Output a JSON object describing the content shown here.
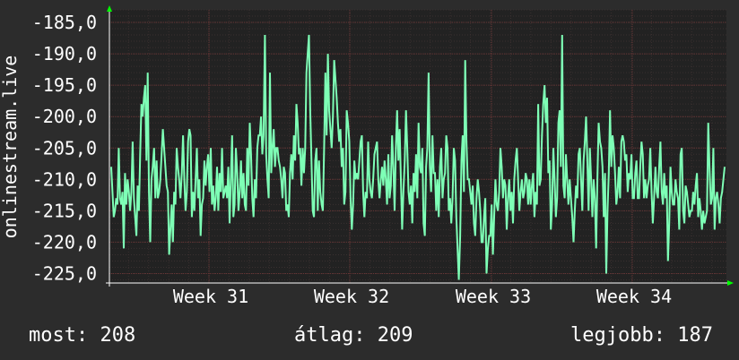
{
  "chart_data": {
    "type": "line",
    "ylabel": "onlinestream.live",
    "y_ticks": [
      -185,
      -190,
      -195,
      -200,
      -205,
      -210,
      -215,
      -220,
      -225
    ],
    "y_tick_labels": [
      "-185,0",
      "-190,0",
      "-195,0",
      "-200,0",
      "-205,0",
      "-210,0",
      "-215,0",
      "-220,0",
      "-225,0"
    ],
    "ylim": [
      -226.5,
      -183
    ],
    "x_tick_labels": [
      "Week 31",
      "Week 32",
      "Week 33",
      "Week 34"
    ],
    "grid": true,
    "series": [
      {
        "color": "#7effb6",
        "values": [
          -208,
          -212,
          -216,
          -215,
          -213,
          -214,
          -205,
          -213,
          -214,
          -212,
          -221,
          -209,
          -214,
          -210,
          -212,
          -215,
          -212,
          -204,
          -213,
          -216,
          -219,
          -211,
          -215,
          -206,
          -198,
          -200,
          -197,
          -195,
          -207,
          -193,
          -212,
          -220,
          -210,
          -208,
          -205,
          -213,
          -207,
          -213,
          -212,
          -210,
          -206,
          -202,
          -205,
          -208,
          -211,
          -212,
          -222,
          -218,
          -214,
          -220,
          -212,
          -214,
          -205,
          -208,
          -210,
          -213,
          -209,
          -203,
          -210,
          -215,
          -212,
          -204,
          -202,
          -203,
          -216,
          -212,
          -215,
          -210,
          -205,
          -213,
          -210,
          -219,
          -214,
          -213,
          -207,
          -211,
          -208,
          -206,
          -212,
          -205,
          -214,
          -211,
          -215,
          -213,
          -208,
          -215,
          -209,
          -212,
          -205,
          -213,
          -212,
          -211,
          -213,
          -208,
          -217,
          -210,
          -203,
          -216,
          -214,
          -205,
          -209,
          -215,
          -212,
          -207,
          -213,
          -209,
          -214,
          -215,
          -205,
          -211,
          -201,
          -206,
          -213,
          -216,
          -210,
          -213,
          -205,
          -203,
          -203,
          -200,
          -206,
          -203,
          -187,
          -206,
          -210,
          -213,
          -193,
          -209,
          -205,
          -202,
          -208,
          -205,
          -205,
          -207,
          -208,
          -210,
          -213,
          -208,
          -209,
          -215,
          -214,
          -216,
          -209,
          -206,
          -210,
          -203,
          -207,
          -198,
          -201,
          -206,
          -205,
          -211,
          -205,
          -209,
          -205,
          -193,
          -190,
          -187,
          -199,
          -207,
          -215,
          -216,
          -207,
          -205,
          -215,
          -207,
          -212,
          -214,
          -215,
          -205,
          -193,
          -203,
          -190,
          -199,
          -202,
          -205,
          -200,
          -191,
          -194,
          -197,
          -201,
          -204,
          -202,
          -208,
          -205,
          -214,
          -212,
          -199,
          -201,
          -204,
          -213,
          -218,
          -214,
          -207,
          -210,
          -209,
          -210,
          -207,
          -204,
          -203,
          -212,
          -216,
          -212,
          -213,
          -204,
          -210,
          -212,
          -213,
          -210,
          -206,
          -205,
          -204,
          -210,
          -213,
          -210,
          -208,
          -211,
          -207,
          -210,
          -214,
          -206,
          -213,
          -211,
          -203,
          -208,
          -215,
          -205,
          -199,
          -207,
          -202,
          -210,
          -218,
          -212,
          -207,
          -199,
          -205,
          -212,
          -214,
          -211,
          -217,
          -209,
          -212,
          -206,
          -213,
          -201,
          -208,
          -209,
          -205,
          -217,
          -219,
          -208,
          -205,
          -193,
          -208,
          -212,
          -203,
          -209,
          -209,
          -215,
          -210,
          -216,
          -208,
          -205,
          -213,
          -210,
          -209,
          -203,
          -205,
          -215,
          -213,
          -217,
          -213,
          -205,
          -207,
          -216,
          -221,
          -226,
          -219,
          -207,
          -203,
          -212,
          -191,
          -204,
          -210,
          -210,
          -212,
          -214,
          -211,
          -217,
          -219,
          -213,
          -210,
          -212,
          -215,
          -220,
          -220,
          -216,
          -213,
          -225,
          -221,
          -219,
          -219,
          -214,
          -222,
          -216,
          -210,
          -214,
          -215,
          -212,
          -205,
          -208,
          -213,
          -210,
          -211,
          -218,
          -213,
          -210,
          -215,
          -212,
          -217,
          -210,
          -207,
          -205,
          -210,
          -215,
          -212,
          -210,
          -213,
          -212,
          -209,
          -210,
          -214,
          -210,
          -214,
          -211,
          -209,
          -216,
          -212,
          -214,
          -198,
          -211,
          -210,
          -203,
          -198,
          -195,
          -201,
          -197,
          -209,
          -207,
          -218,
          -214,
          -205,
          -210,
          -216,
          -213,
          -201,
          -199,
          -208,
          -187,
          -211,
          -213,
          -206,
          -210,
          -214,
          -210,
          -213,
          -216,
          -220,
          -215,
          -211,
          -213,
          -206,
          -205,
          -210,
          -215,
          -207,
          -204,
          -200,
          -207,
          -215,
          -205,
          -210,
          -216,
          -210,
          -213,
          -221,
          -210,
          -201,
          -204,
          -205,
          -208,
          -216,
          -209,
          -225,
          -215,
          -209,
          -199,
          -208,
          -203,
          -205,
          -209,
          -214,
          -212,
          -208,
          -213,
          -204,
          -203,
          -204,
          -207,
          -206,
          -212,
          -209,
          -210,
          -206,
          -213,
          -213,
          -209,
          -207,
          -213,
          -213,
          -208,
          -204,
          -206,
          -213,
          -210,
          -213,
          -211,
          -210,
          -205,
          -212,
          -217,
          -213,
          -208,
          -212,
          -213,
          -208,
          -204,
          -212,
          -214,
          -209,
          -213,
          -211,
          -223,
          -217,
          -208,
          -212,
          -214,
          -214,
          -210,
          -212,
          -213,
          -218,
          -206,
          -205,
          -215,
          -217,
          -211,
          -212,
          -214,
          -216,
          -215,
          -215,
          -212,
          -214,
          -211,
          -209,
          -216,
          -213,
          -215,
          -218,
          -215,
          -217,
          -216,
          -215,
          -201,
          -208,
          -214,
          -213,
          -205,
          -218,
          -213,
          -212,
          -214,
          -217,
          -213,
          -212,
          -210,
          -208
        ]
      }
    ]
  },
  "stats": {
    "now": "most: 208",
    "avg": "átlag: 209",
    "best": "legjobb: 187"
  }
}
